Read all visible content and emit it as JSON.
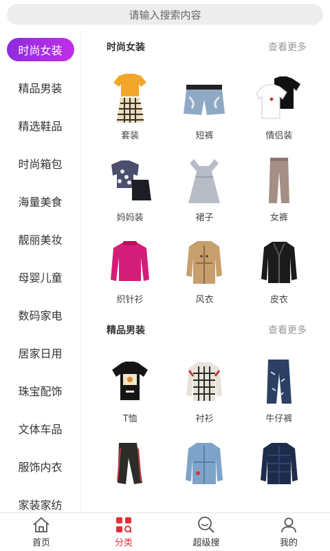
{
  "search": {
    "placeholder": "请输入搜索内容"
  },
  "sidebar": {
    "items": [
      {
        "label": "时尚女装",
        "active": true
      },
      {
        "label": "精品男装"
      },
      {
        "label": "精选鞋品"
      },
      {
        "label": "时尚箱包"
      },
      {
        "label": "海量美食"
      },
      {
        "label": "靓丽美妆"
      },
      {
        "label": "母婴儿童"
      },
      {
        "label": "数码家电"
      },
      {
        "label": "居家日用"
      },
      {
        "label": "珠宝配饰"
      },
      {
        "label": "文体车品"
      },
      {
        "label": "服饰内衣"
      },
      {
        "label": "家装家纺"
      }
    ]
  },
  "sections": [
    {
      "title": "时尚女装",
      "more": "查看更多",
      "items": [
        {
          "label": "套装",
          "icon": "outfit-set-icon"
        },
        {
          "label": "短裤",
          "icon": "denim-shorts-icon"
        },
        {
          "label": "情侣装",
          "icon": "couple-tshirts-icon"
        },
        {
          "label": "妈妈装",
          "icon": "mom-outfit-icon"
        },
        {
          "label": "裙子",
          "icon": "dress-icon"
        },
        {
          "label": "女裤",
          "icon": "trousers-icon"
        },
        {
          "label": "织针衫",
          "icon": "knit-sweater-icon"
        },
        {
          "label": "风衣",
          "icon": "trench-coat-icon"
        },
        {
          "label": "皮衣",
          "icon": "leather-jacket-icon"
        }
      ]
    },
    {
      "title": "精品男装",
      "more": "查看更多",
      "items": [
        {
          "label": "T恤",
          "icon": "tshirt-icon"
        },
        {
          "label": "衬衫",
          "icon": "plaid-shirt-icon"
        },
        {
          "label": "牛仔裤",
          "icon": "jeans-icon"
        },
        {
          "label": "",
          "icon": "jogger-pants-icon"
        },
        {
          "label": "",
          "icon": "denim-jacket-icon"
        },
        {
          "label": "",
          "icon": "padded-jacket-icon"
        }
      ]
    }
  ],
  "tabbar": {
    "tabs": [
      {
        "label": "首页",
        "icon": "home-icon"
      },
      {
        "label": "分类",
        "icon": "category-icon",
        "active": true
      },
      {
        "label": "超级搜",
        "icon": "search-icon"
      },
      {
        "label": "我的",
        "icon": "user-icon"
      }
    ]
  },
  "colors": {
    "accent_start": "#8f2be0",
    "accent_end": "#c12ee8",
    "tab_active": "#e0303a"
  }
}
